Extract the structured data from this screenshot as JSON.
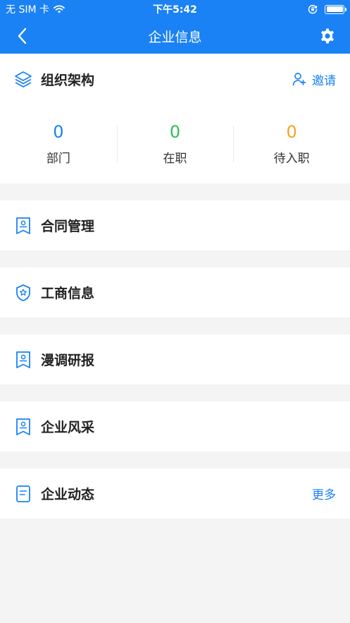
{
  "status_bar": {
    "carrier": "无 SIM 卡",
    "time": "下午5:42"
  },
  "nav": {
    "title": "企业信息"
  },
  "org": {
    "title": "组织架构",
    "invite_label": "邀请",
    "stats": [
      {
        "value": "0",
        "label": "部门",
        "color": "#1a82f5"
      },
      {
        "value": "0",
        "label": "在职",
        "color": "#2ec05a"
      },
      {
        "value": "0",
        "label": "待入职",
        "color": "#f5a623"
      }
    ]
  },
  "menu": [
    {
      "label": "合同管理",
      "icon": "contract-icon"
    },
    {
      "label": "工商信息",
      "icon": "badge-icon"
    },
    {
      "label": "漫调研报",
      "icon": "report-icon"
    },
    {
      "label": "企业风采",
      "icon": "showcase-icon"
    },
    {
      "label": "企业动态",
      "icon": "news-icon",
      "more": "更多"
    }
  ],
  "colors": {
    "accent": "#1a82f5",
    "background": "#f4f4f4"
  }
}
